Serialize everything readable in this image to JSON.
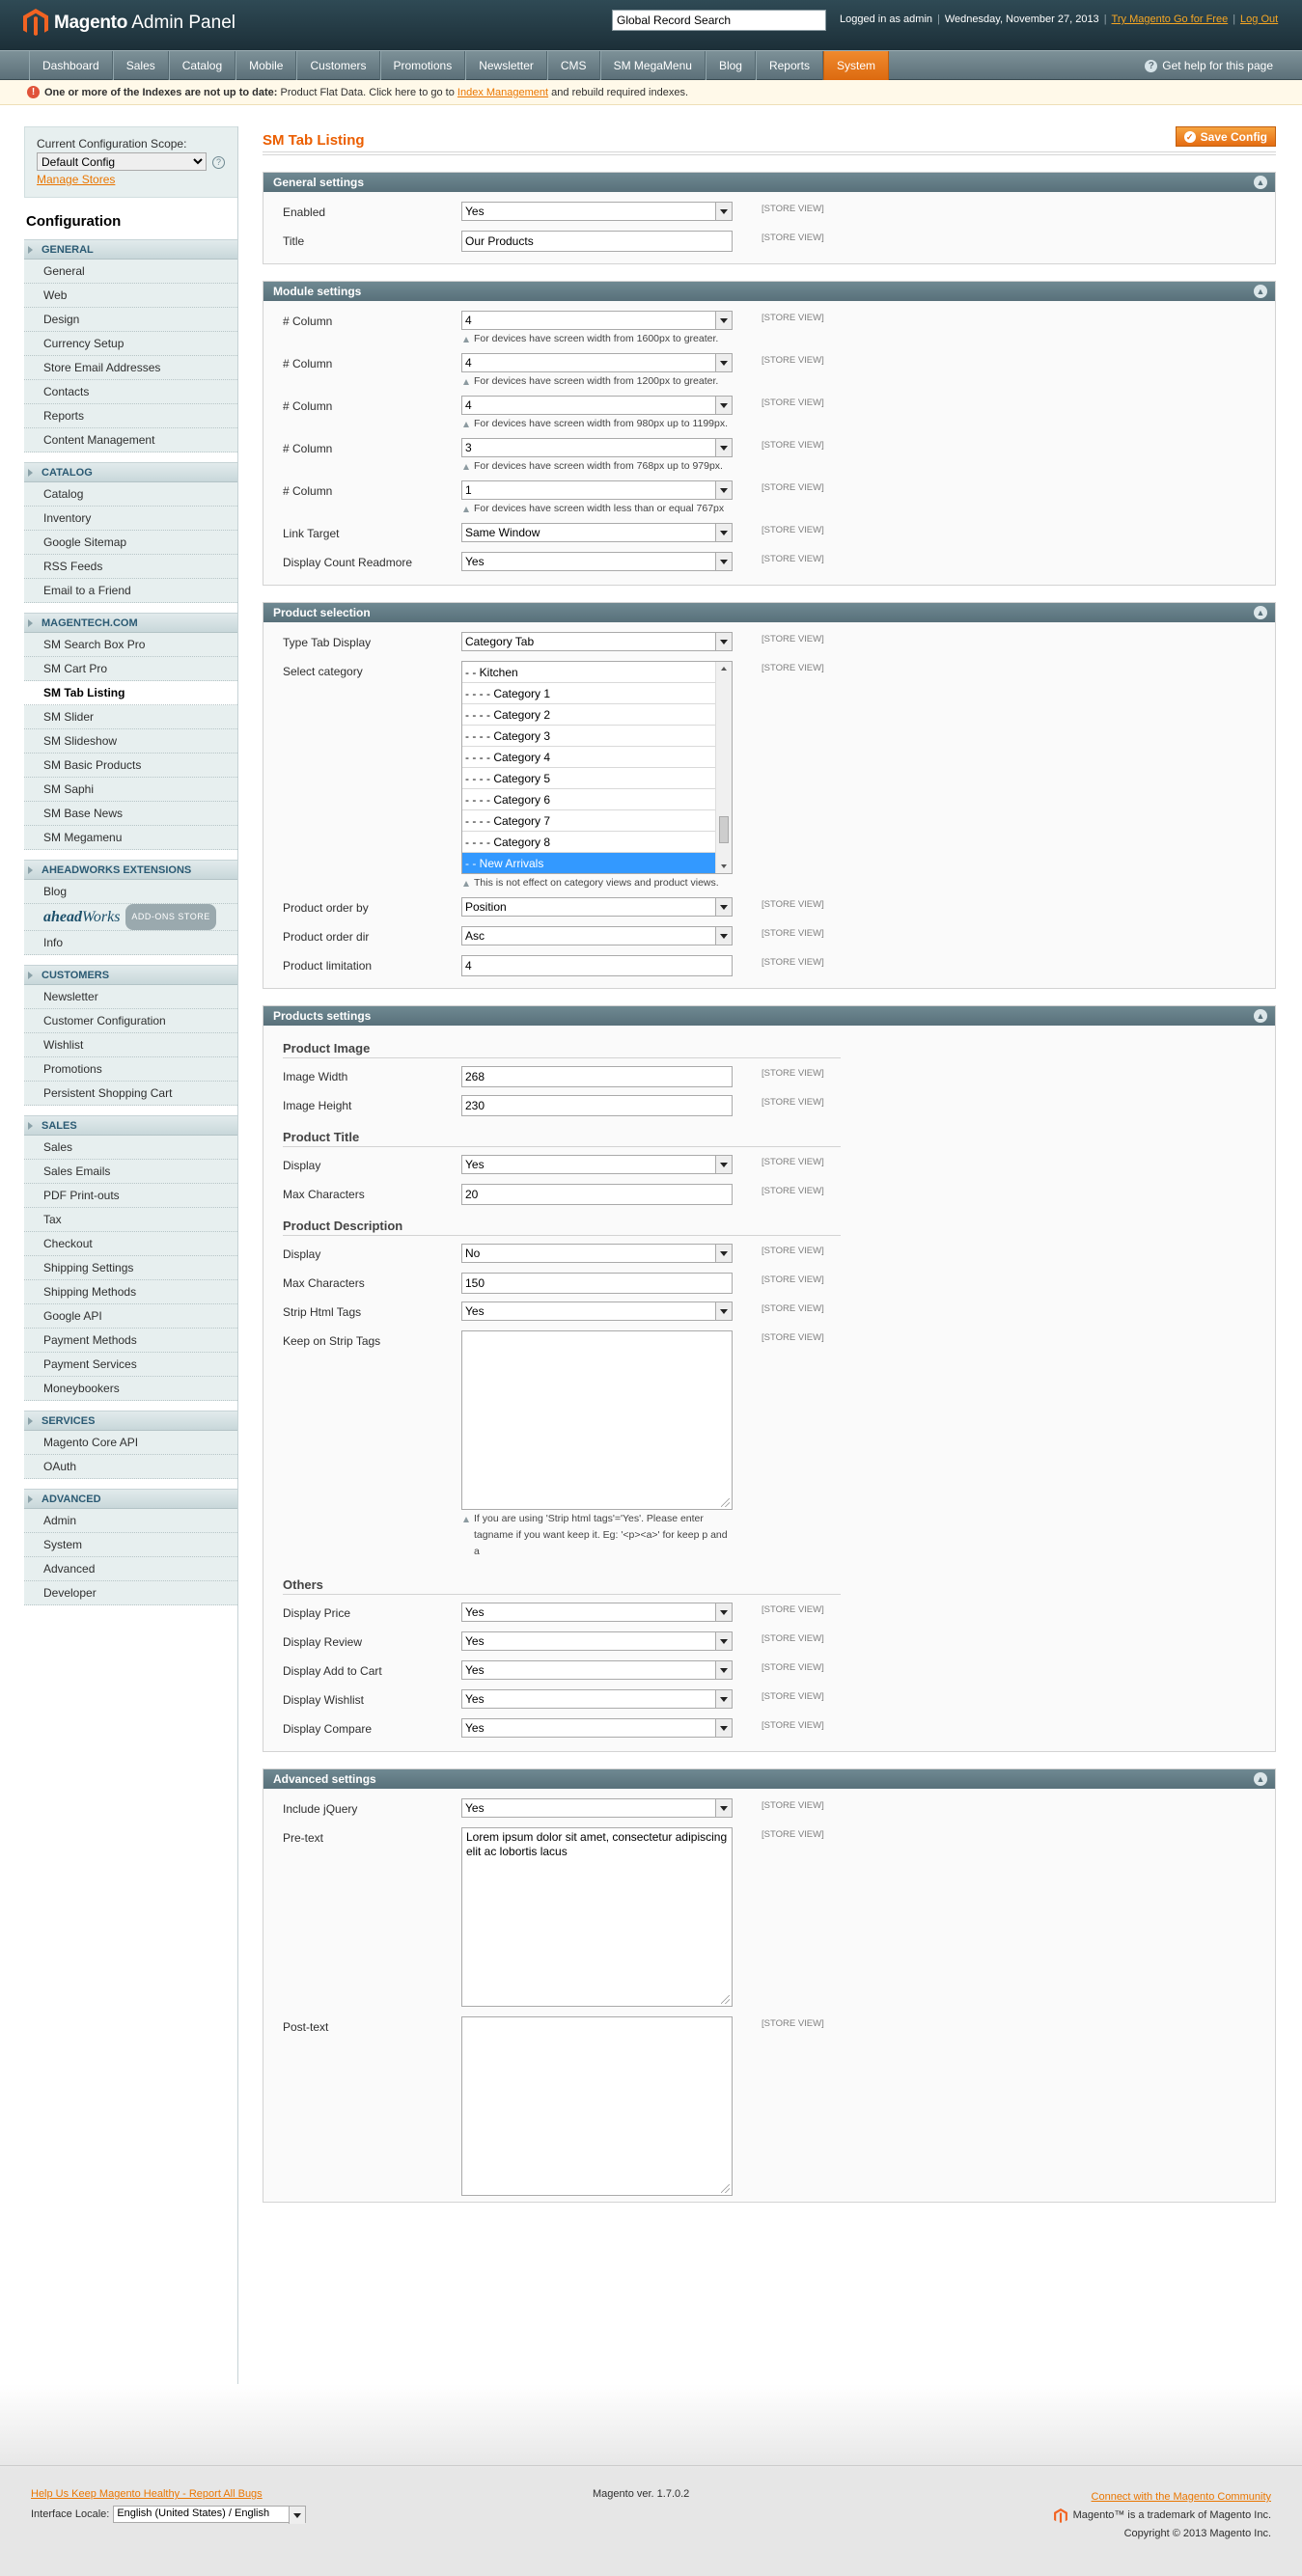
{
  "header": {
    "logo_brand": "Magento",
    "logo_text": "Admin Panel",
    "search_value": "Global Record Search",
    "logged_in": "Logged in as admin",
    "date": "Wednesday, November 27, 2013",
    "try_link": "Try Magento Go for Free",
    "logout": "Log Out"
  },
  "nav": {
    "items": [
      "Dashboard",
      "Sales",
      "Catalog",
      "Mobile",
      "Customers",
      "Promotions",
      "Newsletter",
      "CMS",
      "SM MegaMenu",
      "Blog",
      "Reports",
      "System"
    ],
    "help": "Get help for this page"
  },
  "notice": {
    "bold": "One or more of the Indexes are not up to date:",
    "text1": "Product Flat Data. Click here to go to",
    "link": "Index Management",
    "text2": "and rebuild required indexes."
  },
  "sidebar": {
    "scope_label": "Current Configuration Scope:",
    "scope_value": "Default Config",
    "manage": "Manage Stores",
    "title": "Configuration",
    "groups": [
      {
        "name": "GENERAL",
        "items": [
          "General",
          "Web",
          "Design",
          "Currency Setup",
          "Store Email Addresses",
          "Contacts",
          "Reports",
          "Content Management"
        ]
      },
      {
        "name": "CATALOG",
        "items": [
          "Catalog",
          "Inventory",
          "Google Sitemap",
          "RSS Feeds",
          "Email to a Friend"
        ]
      },
      {
        "name": "MAGENTECH.COM",
        "items": [
          "SM Search Box Pro",
          "SM Cart Pro",
          "SM Tab Listing",
          "SM Slider",
          "SM Slideshow",
          "SM Basic Products",
          "SM Saphi",
          "SM Base News",
          "SM Megamenu"
        ]
      },
      {
        "name": "AHEADWORKS EXTENSIONS",
        "items": [
          "Blog"
        ],
        "logo_a": "ahead",
        "logo_b": "Works",
        "logo_c": "ADD-ONS STORE",
        "extra": "Info"
      },
      {
        "name": "CUSTOMERS",
        "items": [
          "Newsletter",
          "Customer Configuration",
          "Wishlist",
          "Promotions",
          "Persistent Shopping Cart"
        ]
      },
      {
        "name": "SALES",
        "items": [
          "Sales",
          "Sales Emails",
          "PDF Print-outs",
          "Tax",
          "Checkout",
          "Shipping Settings",
          "Shipping Methods",
          "Google API",
          "Payment Methods",
          "Payment Services",
          "Moneybookers"
        ]
      },
      {
        "name": "SERVICES",
        "items": [
          "Magento Core API",
          "OAuth"
        ]
      },
      {
        "name": "ADVANCED",
        "items": [
          "Admin",
          "System",
          "Advanced",
          "Developer"
        ]
      }
    ]
  },
  "main": {
    "title": "SM Tab Listing",
    "save": "Save Config",
    "scope_tag": "[STORE VIEW]",
    "general": {
      "title": "General settings",
      "enabled_label": "Enabled",
      "enabled": "Yes",
      "title_label": "Title",
      "title_value": "Our Products"
    },
    "module": {
      "title": "Module settings",
      "col_label": "# Column",
      "cols": [
        {
          "v": "4",
          "n": "For devices have screen width from 1600px to greater."
        },
        {
          "v": "4",
          "n": "For devices have screen width from 1200px to greater."
        },
        {
          "v": "4",
          "n": "For devices have screen width from 980px up to 1199px."
        },
        {
          "v": "3",
          "n": "For devices have screen width from 768px up to 979px."
        },
        {
          "v": "1",
          "n": "For devices have screen width less than or equal 767px"
        }
      ],
      "link_label": "Link Target",
      "link": "Same Window",
      "readmore_label": "Display Count Readmore",
      "readmore": "Yes"
    },
    "product": {
      "title": "Product selection",
      "type_label": "Type Tab Display",
      "type": "Category Tab",
      "cat_label": "Select category",
      "cats": [
        "- - Kitchen",
        "- - - - Category 1",
        "- - - - Category 2",
        "- - - - Category 3",
        "- - - - Category 4",
        "- - - - Category 5",
        "- - - - Category 6",
        "- - - - Category 7",
        "- - - - Category 8",
        "- - New Arrivals"
      ],
      "cat_note": "This is not effect on category views and product views.",
      "order_label": "Product order by",
      "order": "Position",
      "dir_label": "Product order dir",
      "dir": "Asc",
      "limit_label": "Product limitation",
      "limit": "4"
    },
    "products": {
      "title": "Products settings",
      "img_h": "Product Image",
      "w_label": "Image Width",
      "w": "268",
      "h_label": "Image Height",
      "h": "230",
      "pt_h": "Product Title",
      "disp_label": "Display",
      "pt_disp": "Yes",
      "max_label": "Max Characters",
      "pt_max": "20",
      "pd_h": "Product Description",
      "pd_disp": "No",
      "pd_max": "150",
      "strip_label": "Strip Html Tags",
      "strip": "Yes",
      "keep_label": "Keep on Strip Tags",
      "keep_note": "If you are using 'Strip html tags'='Yes'. Please enter tagname if you want keep it. Eg: '<p><a>' for keep p and a",
      "others_h": "Others",
      "price_label": "Display Price",
      "review_label": "Display Review",
      "cart_label": "Display Add to Cart",
      "wish_label": "Display Wishlist",
      "compare_label": "Display Compare",
      "yes": "Yes"
    },
    "advanced": {
      "title": "Advanced settings",
      "jq_label": "Include jQuery",
      "jq": "Yes",
      "pre_label": "Pre-text",
      "pre": "Lorem ipsum dolor sit amet, consectetur adipiscing elit ac lobortis lacus",
      "post_label": "Post-text"
    }
  },
  "footer": {
    "bugs": "Help Us Keep Magento Healthy - Report All Bugs",
    "locale_label": "Interface Locale:",
    "locale": "English (United States) / English",
    "version": "Magento ver. 1.7.0.2",
    "connect": "Connect with the Magento Community",
    "trademark": "Magento™ is a trademark of Magento Inc.",
    "copyright": "Copyright © 2013 Magento Inc."
  },
  "colors": {
    "accent": "#eb5e00",
    "nav": "#6f8992",
    "sidebar": "#e7efef"
  }
}
